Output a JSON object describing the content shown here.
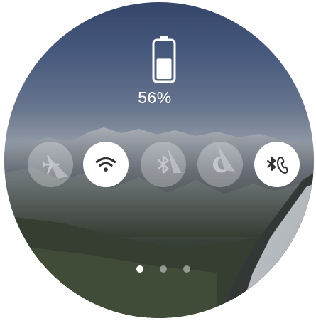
{
  "battery": {
    "percent_label": "56%",
    "level": 0.56,
    "icon": "battery-icon"
  },
  "toggles": [
    {
      "name": "airplane-mode",
      "icon": "airplane-icon",
      "active": false
    },
    {
      "name": "wifi",
      "icon": "wifi-icon",
      "active": true
    },
    {
      "name": "bluetooth",
      "icon": "bluetooth-icon",
      "active": false
    },
    {
      "name": "do-not-disturb",
      "icon": "moon-icon",
      "active": false
    },
    {
      "name": "bluetooth-call",
      "icon": "bluetooth-call-icon",
      "active": true
    }
  ],
  "pager": {
    "pages": 3,
    "current": 1
  },
  "colors": {
    "active_bg": "#ffffff",
    "active_icon": "#333333",
    "inactive_bg": "rgba(255,255,255,0.28)",
    "inactive_icon": "#bfc3c9"
  }
}
